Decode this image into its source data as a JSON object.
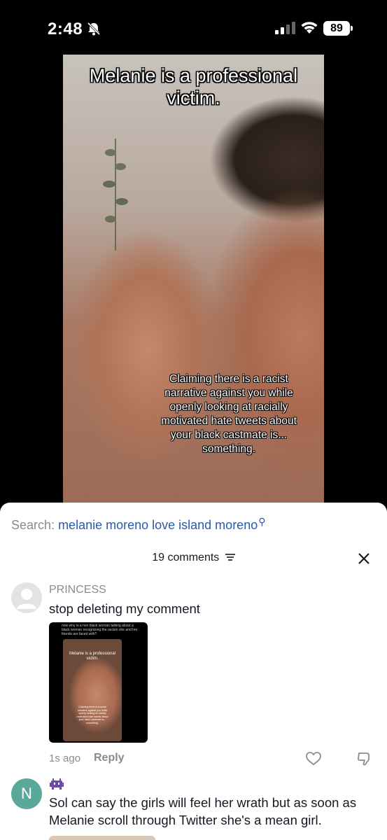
{
  "status_bar": {
    "time": "2:48",
    "battery": "89"
  },
  "video": {
    "caption_top": "Melanie is a professional victim.",
    "caption_bottom": "Claiming there is a racist narrative against you while openly looking at racially motivated hate tweets about your black castmate is... something."
  },
  "search": {
    "label": "Search:",
    "query": "melanie moreno love island moreno"
  },
  "comments_header": {
    "count_label": "19 comments"
  },
  "comments": [
    {
      "username": "PRINCESS",
      "text": "stop deleting my comment",
      "thumbnail": {
        "caption": "now why is a non black woman talking about a black woman recognizing the racism she and her friends are faced with?",
        "video_title": "Melanie is a professional victim.",
        "video_body": "Claiming there is a racist narrative against you while openly looking at racially motivated hate tweets about your black castmate is... something."
      },
      "time": "1s ago",
      "reply_label": "Reply"
    },
    {
      "avatar_letter": "N",
      "text": "Sol can say the girls will feel her wrath but as soon as Melanie scroll through Twitter she's a mean girl."
    }
  ],
  "colors": {
    "link": "#2b5aa6",
    "muted": "#8a8b91",
    "avatar_n": "#5aa89a"
  }
}
